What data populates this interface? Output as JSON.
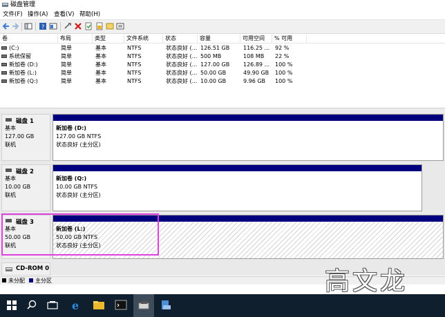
{
  "window": {
    "title": "磁盘管理"
  },
  "menu": [
    "文件(F)",
    "操作(A)",
    "查看(V)",
    "帮助(H)"
  ],
  "toolbar_icons": [
    "back-icon",
    "forward-icon",
    "show-hide-tree-icon",
    "help-icon",
    "properties-icon",
    "connect-icon",
    "delete-icon",
    "check-icon",
    "export-icon",
    "refresh-icon",
    "rescan-icon"
  ],
  "volumes": {
    "headers": [
      "卷",
      "布局",
      "类型",
      "文件系统",
      "状态",
      "容量",
      "可用空间",
      "% 可用"
    ],
    "rows": [
      [
        "(C:)",
        "简单",
        "基本",
        "NTFS",
        "状态良好 (...",
        "126.51 GB",
        "116.25 ...",
        "92 %"
      ],
      [
        "系统保留",
        "简单",
        "基本",
        "NTFS",
        "状态良好 (...",
        "500 MB",
        "108 MB",
        "22 %"
      ],
      [
        "新加卷 (D:)",
        "简单",
        "基本",
        "NTFS",
        "状态良好 (...",
        "127.00 GB",
        "126.89 ...",
        "100 %"
      ],
      [
        "新加卷 (L:)",
        "简单",
        "基本",
        "NTFS",
        "状态良好 (...",
        "50.00 GB",
        "49.90 GB",
        "100 %"
      ],
      [
        "新加卷 (Q:)",
        "简单",
        "基本",
        "NTFS",
        "状态良好 (...",
        "10.00 GB",
        "9.96 GB",
        "100 %"
      ]
    ]
  },
  "disks": [
    {
      "name": "磁盘 1",
      "type": "基本",
      "size": "127.00 GB",
      "status": "联机",
      "partition": {
        "name": "新加卷 (D:)",
        "size": "127.00 GB NTFS",
        "status": "状态良好 (主分区)"
      }
    },
    {
      "name": "磁盘 2",
      "type": "基本",
      "size": "10.00 GB",
      "status": "联机",
      "partition": {
        "name": "新加卷 (Q:)",
        "size": "10.00 GB NTFS",
        "status": "状态良好 (主分区)"
      }
    },
    {
      "name": "磁盘 3",
      "type": "基本",
      "size": "50.00 GB",
      "status": "联机",
      "partition": {
        "name": "新加卷 (L:)",
        "size": "50.00 GB NTFS",
        "status": "状态良好 (主分区)"
      }
    }
  ],
  "cdrom": {
    "name": "CD-ROM 0"
  },
  "legend": [
    {
      "label": "未分配",
      "color": "#000000"
    },
    {
      "label": "主分区",
      "color": "#00007f"
    }
  ],
  "taskbar_icons": [
    "windows-start-icon",
    "search-icon",
    "task-view-icon",
    "edge-browser-icon",
    "file-explorer-icon",
    "command-prompt-icon",
    "disk-management-icon",
    "server-manager-icon"
  ],
  "watermark": "高文龙",
  "colors": {
    "partition_bar": "#00007f",
    "highlight": "#e040e0",
    "taskbar": "#0f1f2e"
  }
}
